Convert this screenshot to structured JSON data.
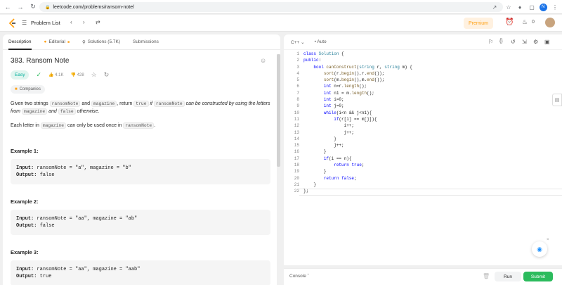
{
  "browser": {
    "url": "leetcode.com/problems/ransom-note/",
    "profile_initial": "N"
  },
  "topbar": {
    "title": "Problem List",
    "premium": "Premium",
    "streak": "0"
  },
  "tabs": [
    {
      "label": "Description",
      "icon": "doc-icon"
    },
    {
      "label": "Editorial",
      "icon": "flask-icon"
    },
    {
      "label": "Solutions (5.7K)",
      "icon": "flask-icon"
    },
    {
      "label": "Submissions",
      "icon": "history-icon"
    }
  ],
  "problem": {
    "title": "383. Ransom Note",
    "difficulty": "Easy",
    "likes": "4.1K",
    "dislikes": "428",
    "companies": "Companies",
    "desc_p1_a": "Given two strings ",
    "desc_code1": "ransomNote",
    "desc_p1_b": " and ",
    "desc_code2": "magazine",
    "desc_p1_c": ", return ",
    "desc_code3": "true",
    "desc_p1_d": " if ",
    "desc_code4": "ransomNote",
    "desc_p1_e": " can be constructed by using the letters from ",
    "desc_code5": "magazine",
    "desc_p1_f": " and ",
    "desc_code6": "false",
    "desc_p1_g": " otherwise.",
    "desc_p2_a": "Each letter in ",
    "desc_code7": "magazine",
    "desc_p2_b": " can only be used once in ",
    "desc_code8": "ransomNote",
    "desc_p2_c": ".",
    "examples": [
      {
        "label": "Example 1:",
        "input": "ransomNote = \"a\", magazine = \"b\"",
        "output": "false"
      },
      {
        "label": "Example 2:",
        "input": "ransomNote = \"aa\", magazine = \"ab\"",
        "output": "false"
      },
      {
        "label": "Example 3:",
        "input": "ransomNote = \"aa\", magazine = \"aab\"",
        "output": "true"
      }
    ],
    "input_label": "Input:",
    "output_label": "Output:"
  },
  "editor": {
    "language": "C++",
    "autocomplete": "Auto",
    "line_numbers": [
      "1",
      "2",
      "3",
      "4",
      "5",
      "6",
      "7",
      "8",
      "9",
      "10",
      "11",
      "12",
      "13",
      "14",
      "15",
      "16",
      "17",
      "18",
      "19",
      "20",
      "21",
      "22"
    ]
  },
  "bottom": {
    "console": "Console",
    "run": "Run",
    "submit": "Submit"
  },
  "colors": {
    "accent": "#ffa116",
    "easy": "#00af9b",
    "submit": "#2cbb5d"
  }
}
